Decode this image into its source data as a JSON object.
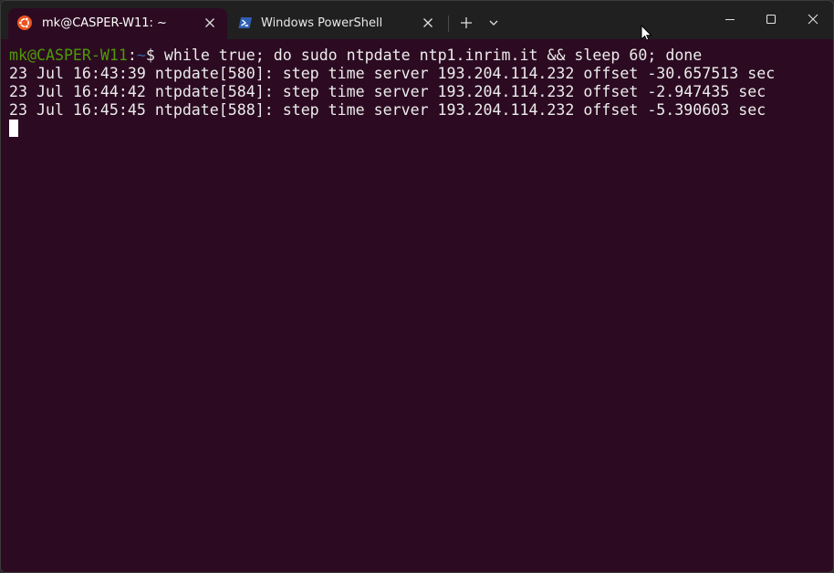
{
  "tabs": [
    {
      "label": "mk@CASPER-W11: ~",
      "icon": "ubuntu-icon",
      "active": true
    },
    {
      "label": "Windows PowerShell",
      "icon": "powershell-icon",
      "active": false
    }
  ],
  "terminal": {
    "prompt": {
      "user_host": "mk@CASPER-W11",
      "separator": ":",
      "path": "~",
      "symbol": "$ "
    },
    "command": "while true; do sudo ntpdate ntp1.inrim.it && sleep 60; done",
    "output": [
      "23 Jul 16:43:39 ntpdate[580]: step time server 193.204.114.232 offset -30.657513 sec",
      "23 Jul 16:44:42 ntpdate[584]: step time server 193.204.114.232 offset -2.947435 sec",
      "23 Jul 16:45:45 ntpdate[588]: step time server 193.204.114.232 offset -5.390603 sec"
    ]
  },
  "colors": {
    "terminal_bg": "#2c0b22",
    "titlebar_bg": "#202020",
    "prompt_user": "#4e9a06",
    "prompt_path": "#3465a4",
    "ubuntu_orange": "#e95420",
    "powershell_blue": "#2f5fb3"
  }
}
